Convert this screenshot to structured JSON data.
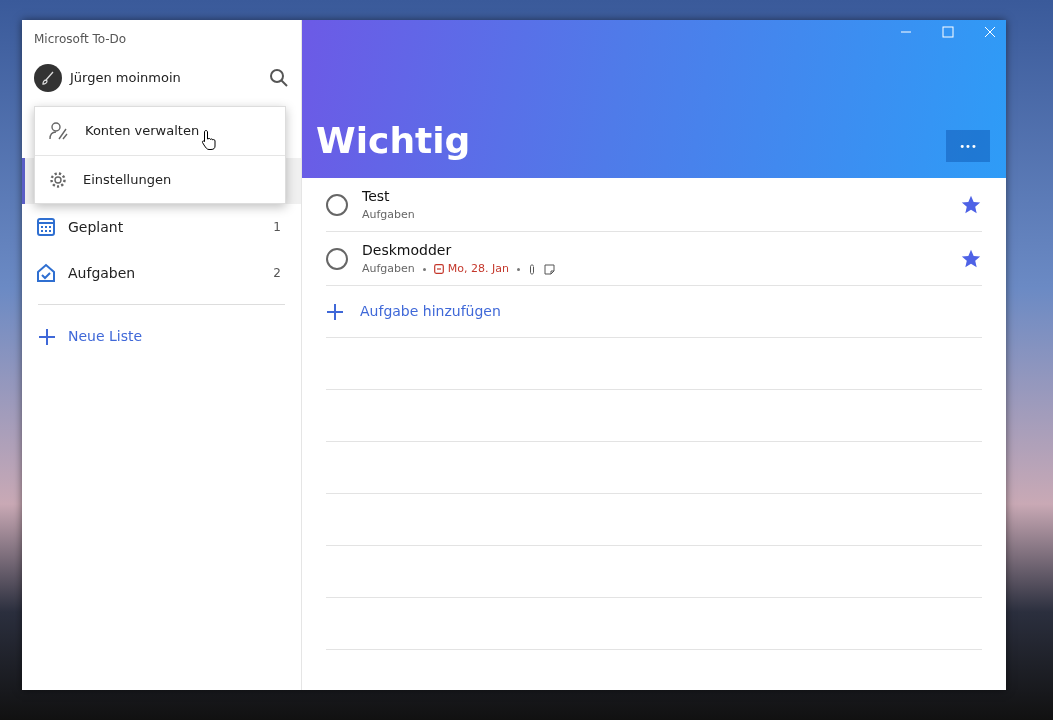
{
  "window": {
    "title": "Microsoft To-Do"
  },
  "account": {
    "name": "Jürgen moinmoin"
  },
  "account_menu": {
    "items": [
      {
        "label": "Konten verwalten",
        "kind": "accounts",
        "hovered": true
      },
      {
        "label": "Einstellungen",
        "kind": "settings",
        "hovered": false
      }
    ]
  },
  "covered_item": {
    "selected": true
  },
  "sidebar": {
    "items": [
      {
        "label": "Geplant",
        "count": "1",
        "kind": "planned",
        "selected": false
      },
      {
        "label": "Aufgaben",
        "count": "2",
        "kind": "tasks",
        "selected": false
      }
    ],
    "new_list": "Neue Liste"
  },
  "list": {
    "title": "Wichtig",
    "more_button": "•••"
  },
  "tasks": [
    {
      "title": "Test",
      "list": "Aufgaben",
      "completed": false,
      "important": true
    },
    {
      "title": "Deskmodder",
      "list": "Aufgaben",
      "due": "Mo, 28. Jan",
      "attachment": true,
      "note": true,
      "completed": false,
      "important": true
    }
  ],
  "add_task": "Aufgabe hinzufügen"
}
